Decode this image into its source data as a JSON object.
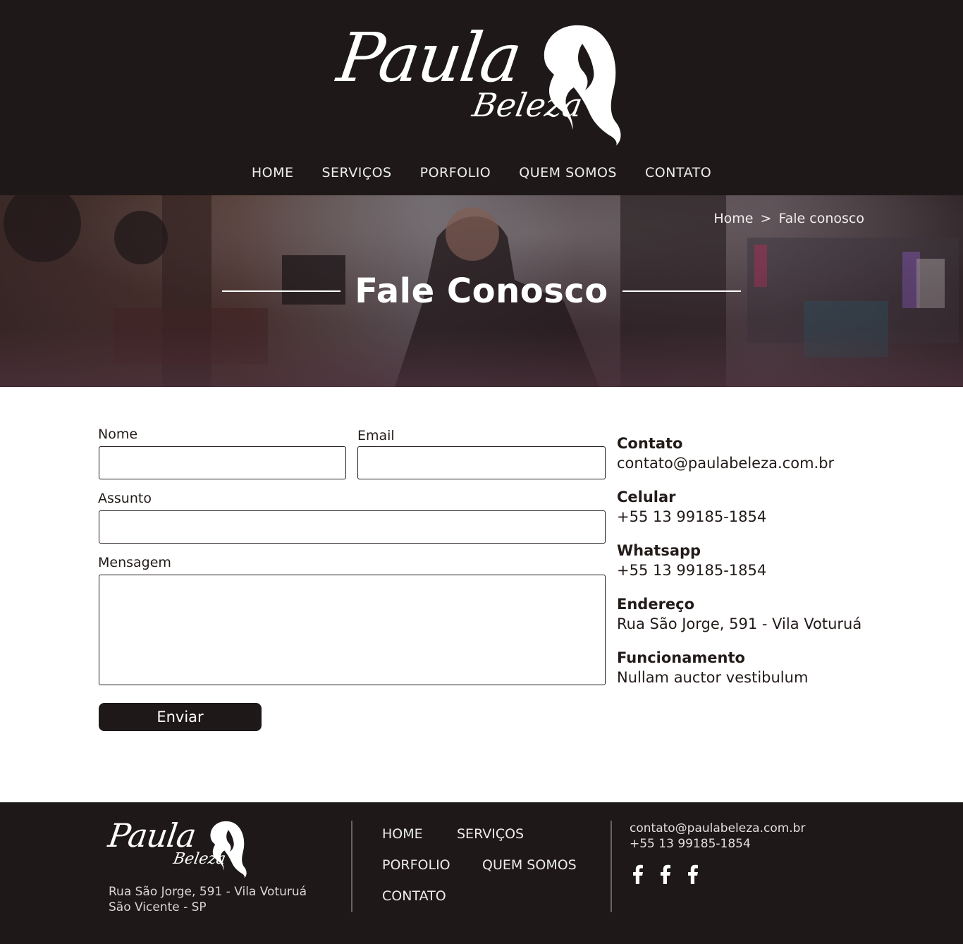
{
  "brand": {
    "name": "Paula",
    "subname": "Beleza"
  },
  "nav": {
    "items": [
      "HOME",
      "SERVIÇOS",
      "PORFOLIO",
      "QUEM SOMOS",
      "CONTATO"
    ]
  },
  "hero": {
    "breadcrumb_home": "Home",
    "breadcrumb_sep": ">",
    "breadcrumb_current": "Fale conosco",
    "title": "Fale Conosco"
  },
  "form": {
    "name_label": "Nome",
    "name_value": "",
    "email_label": "Email",
    "email_value": "",
    "subject_label": "Assunto",
    "subject_value": "",
    "message_label": "Mensagem",
    "message_value": "",
    "submit_label": "Enviar"
  },
  "info": [
    {
      "title": "Contato",
      "value": "contato@paulabeleza.com.br"
    },
    {
      "title": "Celular",
      "value": "+55 13 99185-1854"
    },
    {
      "title": "Whatsapp",
      "value": "+55 13 99185-1854"
    },
    {
      "title": "Endereço",
      "value": "Rua São Jorge, 591 - Vila Voturuá"
    },
    {
      "title": "Funcionamento",
      "value": "Nullam auctor vestibulum"
    }
  ],
  "footer": {
    "address_line1": "Rua São Jorge, 591 -  Vila Voturuá",
    "address_line2": "São Vicente - SP",
    "nav": [
      "HOME",
      "SERVIÇOS",
      "PORFOLIO",
      "QUEM SOMOS",
      "CONTATO"
    ],
    "email": "contato@paulabeleza.com.br",
    "phone": "+55 13 99185-1854",
    "social_icons": [
      "facebook-icon",
      "facebook-icon",
      "facebook-icon"
    ]
  },
  "colors": {
    "dark": "#1e1918",
    "text": "#231b19",
    "white": "#ffffff"
  }
}
